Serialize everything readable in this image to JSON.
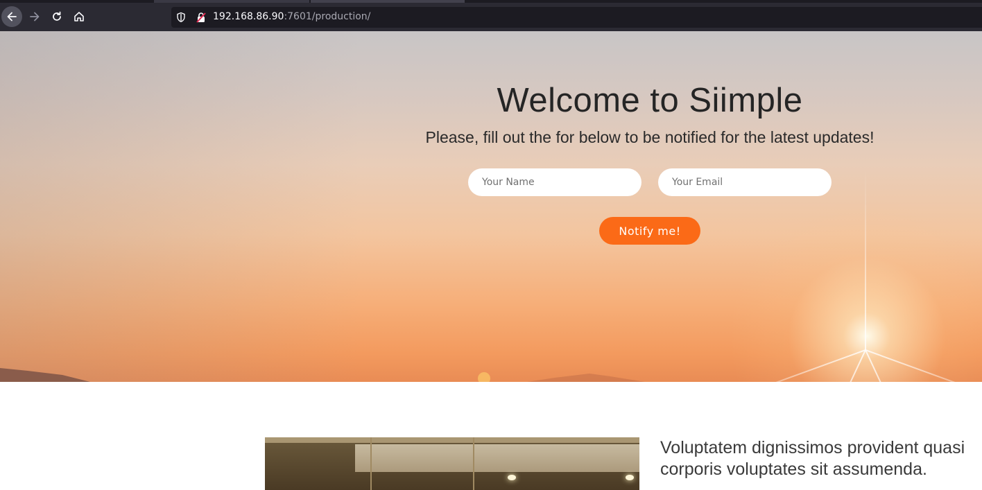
{
  "browser": {
    "url_host": "192.168.86.90",
    "url_rest": ":7601/production/",
    "icons": [
      "back-arrow-icon",
      "forward-arrow-icon",
      "reload-icon",
      "home-icon",
      "shield-icon",
      "insecure-lock-icon"
    ]
  },
  "hero": {
    "title": "Welcome to Siimple",
    "subtitle": "Please, fill out the for below to be notified for the latest updates!",
    "name_placeholder": "Your Name",
    "email_placeholder": "Your Email",
    "button_label": "Notify me!"
  },
  "section": {
    "text": "Voluptatem dignissimos provident quasi corporis voluptates sit assumenda."
  },
  "colors": {
    "accent": "#fb6a17",
    "chrome_toolbar": "#2b2a33",
    "chrome_urlbar": "#1c1b22"
  }
}
